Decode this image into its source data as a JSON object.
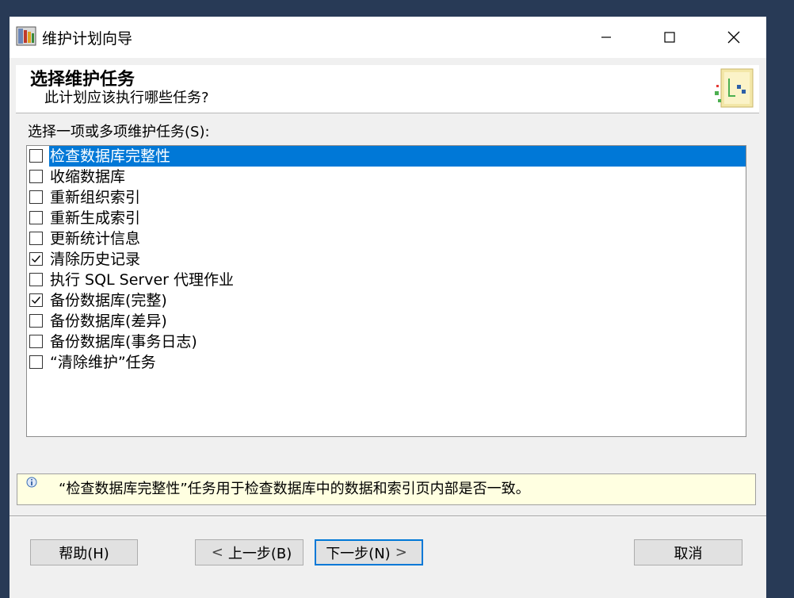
{
  "window": {
    "title": "维护计划向导",
    "controls": {
      "minimize": "minimize-icon",
      "maximize": "maximize-icon",
      "close": "close-icon"
    }
  },
  "header": {
    "title": "选择维护任务",
    "subtitle": "此计划应该执行哪些任务?"
  },
  "task_list": {
    "label": "选择一项或多项维护任务(S):",
    "items": [
      {
        "label": "检查数据库完整性",
        "checked": false,
        "selected": true
      },
      {
        "label": "收缩数据库",
        "checked": false,
        "selected": false
      },
      {
        "label": "重新组织索引",
        "checked": false,
        "selected": false
      },
      {
        "label": "重新生成索引",
        "checked": false,
        "selected": false
      },
      {
        "label": "更新统计信息",
        "checked": false,
        "selected": false
      },
      {
        "label": "清除历史记录",
        "checked": true,
        "selected": false
      },
      {
        "label": "执行 SQL Server 代理作业",
        "checked": false,
        "selected": false
      },
      {
        "label": "备份数据库(完整)",
        "checked": true,
        "selected": false
      },
      {
        "label": "备份数据库(差异)",
        "checked": false,
        "selected": false
      },
      {
        "label": "备份数据库(事务日志)",
        "checked": false,
        "selected": false
      },
      {
        "label": "“清除维护”任务",
        "checked": false,
        "selected": false
      }
    ]
  },
  "info": {
    "text": "“检查数据库完整性”任务用于检查数据库中的数据和索引页内部是否一致。"
  },
  "buttons": {
    "help": "帮助(H)",
    "back": "上一步(B)",
    "next": "下一步(N)",
    "cancel": "取消"
  },
  "colors": {
    "selection": "#0078d7",
    "info_background": "#ffffe1",
    "desktop": "#283a56",
    "dialog": "#f0f0f0"
  }
}
